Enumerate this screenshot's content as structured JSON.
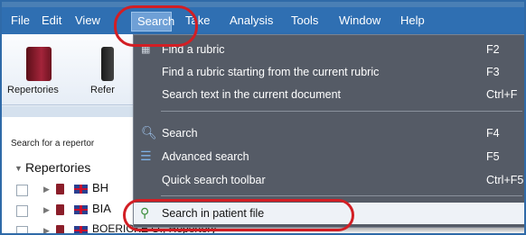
{
  "menubar": {
    "items": [
      "File",
      "Edit",
      "View",
      "Search",
      "Take",
      "Analysis",
      "Tools",
      "Window",
      "Help"
    ],
    "active": "Search"
  },
  "toolbar": {
    "buttons": [
      "Repertories",
      "Refer"
    ]
  },
  "left_panel": {
    "search_label": "Search for a repertor",
    "repertories_header": "Repertories",
    "rows": [
      "BH",
      "BIA",
      "BOERICKE O., Repertory"
    ]
  },
  "search_menu": {
    "items": [
      {
        "label": "Find a rubric",
        "shortcut": "F2"
      },
      {
        "label": "Find a rubric starting from the current rubric",
        "shortcut": "F3"
      },
      {
        "label": "Search text in the current document",
        "shortcut": "Ctrl+F"
      },
      {
        "label": "Search",
        "shortcut": "F4"
      },
      {
        "label": "Advanced search",
        "shortcut": "F5"
      },
      {
        "label": "Quick search toolbar",
        "shortcut": "Ctrl+F5"
      },
      {
        "label": "Search in patient file",
        "shortcut": ""
      }
    ]
  },
  "colors": {
    "menubar": "#2f6fb2",
    "dropdown": "#555b66",
    "annotation": "#d21e24",
    "book": "#8b1e2a"
  }
}
